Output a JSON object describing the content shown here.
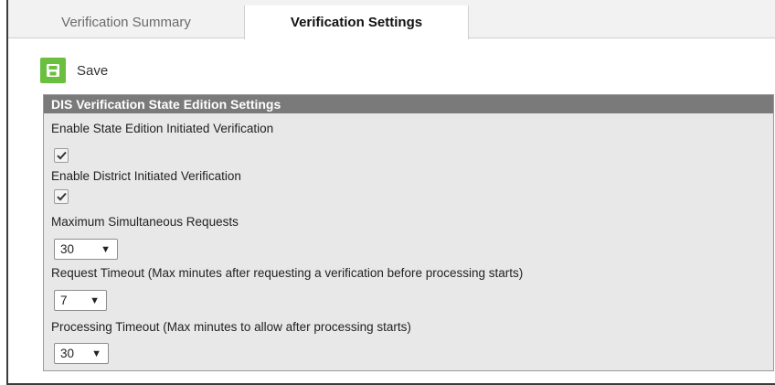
{
  "tabs": [
    {
      "label": "Verification Summary",
      "active": false
    },
    {
      "label": "Verification Settings",
      "active": true
    }
  ],
  "toolbar": {
    "save_label": "Save",
    "save_icon": "floppy-disk-icon",
    "accent": "#6bbf3e"
  },
  "panel": {
    "title": "DIS Verification State Edition Settings",
    "fields": {
      "state_edition": {
        "label": "Enable State Edition Initiated Verification",
        "checked": true
      },
      "district": {
        "label": "Enable District Initiated Verification",
        "checked": true
      },
      "max_requests": {
        "label": "Maximum Simultaneous Requests",
        "value": "30"
      },
      "request_timeout": {
        "label": "Request Timeout (Max minutes after requesting a verification before processing starts)",
        "value": "7"
      },
      "processing_timeout": {
        "label": "Processing Timeout (Max minutes to allow after processing starts)",
        "value": "30"
      }
    }
  }
}
